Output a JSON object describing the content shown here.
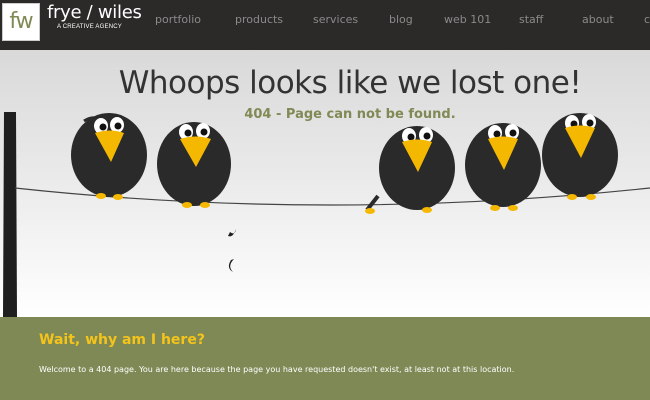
{
  "brand": {
    "logo_monogram": "fw",
    "name": "frye / wiles",
    "tagline": "A CREATIVE AGENCY"
  },
  "nav": {
    "items": [
      "portfolio",
      "products",
      "services",
      "blog",
      "web 101",
      "staff",
      "about",
      "c"
    ]
  },
  "hero": {
    "headline": "Whoops looks like we lost one!",
    "subheadline": "404 - Page can not be found."
  },
  "footer": {
    "title": "Wait, why am I here?",
    "text": "Welcome to a 404 page. You are here because the page you have requested doesn't exist, at least not at this location."
  },
  "colors": {
    "header_bg": "#2b2a29",
    "accent_olive": "#7e8955",
    "accent_yellow": "#f5c41b",
    "crow_body": "#2a2a2a"
  }
}
